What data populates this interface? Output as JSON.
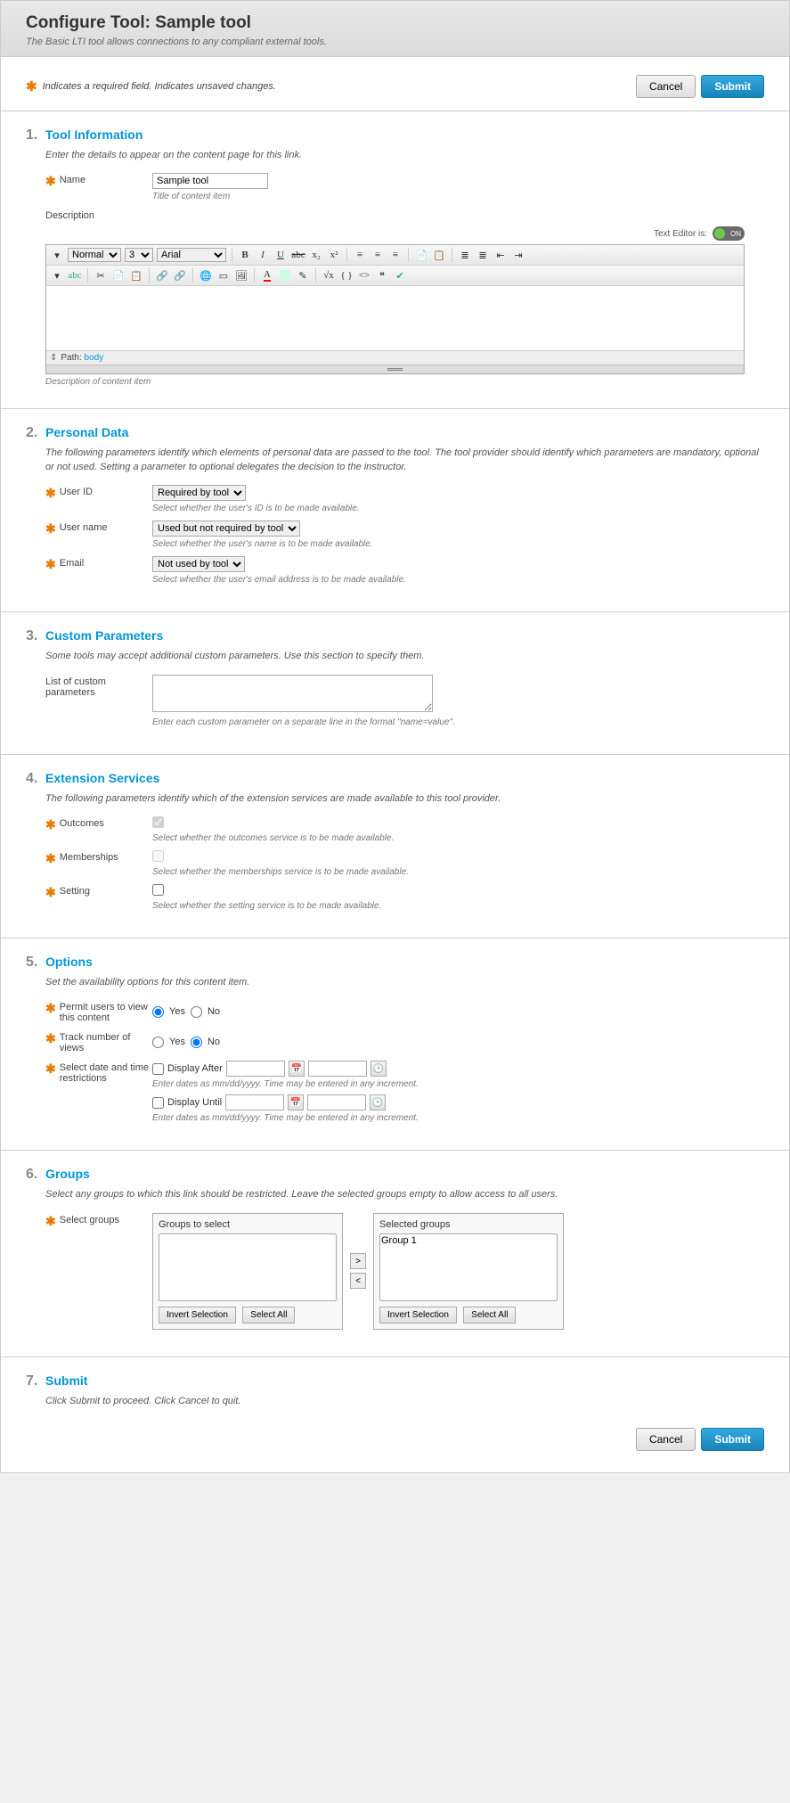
{
  "header": {
    "title": "Configure Tool: Sample tool",
    "subtitle": "The Basic LTI tool allows connections to any compliant external tools."
  },
  "reqbar": {
    "text": "Indicates a required field. Indicates unsaved changes.",
    "cancel": "Cancel",
    "submit": "Submit"
  },
  "sections": {
    "tool_info": {
      "num": "1.",
      "title": "Tool Information",
      "desc": "Enter the details to appear on the content page for this link.",
      "name_label": "Name",
      "name_value": "Sample tool",
      "name_help": "Title of content item",
      "description_label": "Description",
      "editor_label": "Text Editor is:",
      "toggle_state": "ON",
      "path_label": "Path:",
      "path_body": "body",
      "desc_help": "Description of content item",
      "fontsel": "Normal",
      "sizesel": "3",
      "facesel": "Arial"
    },
    "personal": {
      "num": "2.",
      "title": "Personal Data",
      "desc": "The following parameters identify which elements of personal data are passed to the tool. The tool provider should identify which parameters are mandatory, optional or not used. Setting a parameter to optional delegates the decision to the instructor.",
      "userid_label": "User ID",
      "userid_value": "Required by tool",
      "userid_help": "Select whether the user's ID is to be made available.",
      "username_label": "User name",
      "username_value": "Used but not required by tool",
      "username_help": "Select whether the user's name is to be made available.",
      "email_label": "Email",
      "email_value": "Not used by tool",
      "email_help": "Select whether the user's email address is to be made available."
    },
    "custom": {
      "num": "3.",
      "title": "Custom Parameters",
      "desc": "Some tools may accept additional custom parameters. Use this section to specify them.",
      "list_label": "List of custom parameters",
      "list_help": "Enter each custom parameter on a separate line in the format \"name=value\"."
    },
    "extension": {
      "num": "4.",
      "title": "Extension Services",
      "desc": "The following parameters identify which of the extension services are made available to this tool provider.",
      "outcomes_label": "Outcomes",
      "outcomes_help": "Select whether the outcomes service is to be made available.",
      "memberships_label": "Memberships",
      "memberships_help": "Select whether the memberships service is to be made available.",
      "setting_label": "Setting",
      "setting_help": "Select whether the setting service is to be made available."
    },
    "options": {
      "num": "5.",
      "title": "Options",
      "desc": "Set the availability options for this content item.",
      "permit_label": "Permit users to view this content",
      "track_label": "Track number of views",
      "restrict_label": "Select date and time restrictions",
      "yes": "Yes",
      "no": "No",
      "display_after": "Display After",
      "display_until": "Display Until",
      "date_help": "Enter dates as mm/dd/yyyy. Time may be entered in any increment."
    },
    "groups": {
      "num": "6.",
      "title": "Groups",
      "desc": "Select any groups to which this link should be restricted. Leave the selected groups empty to allow access to all users.",
      "select_label": "Select groups",
      "to_select": "Groups to select",
      "selected": "Selected groups",
      "group1": "Group 1",
      "invert": "Invert Selection",
      "selectall": "Select All"
    },
    "submit": {
      "num": "7.",
      "title": "Submit",
      "desc": "Click Submit to proceed. Click Cancel to quit."
    }
  }
}
